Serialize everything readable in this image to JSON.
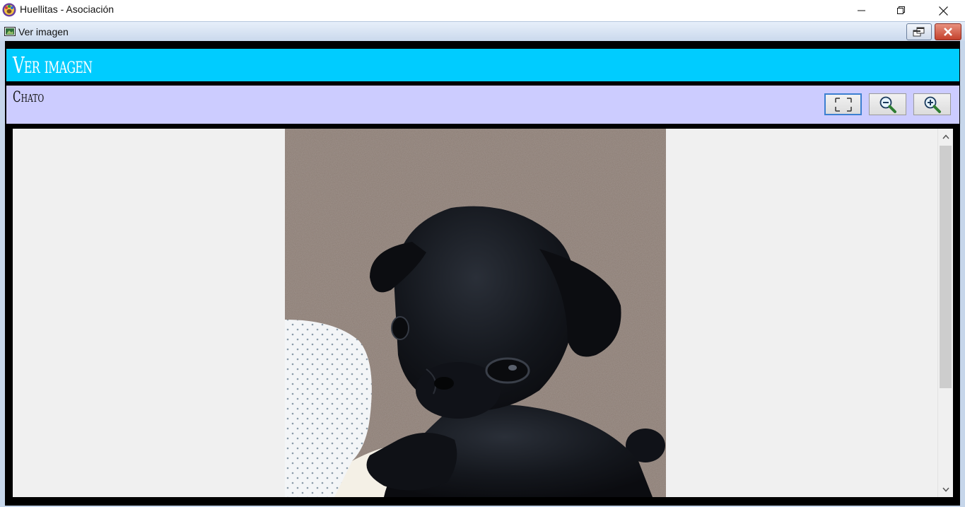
{
  "window": {
    "title": "Huellitas - Asociación",
    "app_icon": "paw-app-icon",
    "controls": [
      "minimize-icon",
      "maximize-icon",
      "close-icon"
    ]
  },
  "child_window": {
    "title": "Ver imagen",
    "icon": "image-window-icon",
    "controls": [
      "restore-icon",
      "close-icon"
    ]
  },
  "page": {
    "title": "Ver imagen",
    "header_color": "#00ccff",
    "subheader_color": "#ccccff"
  },
  "pet": {
    "name": "Chato"
  },
  "toolbar": {
    "buttons": [
      {
        "icon": "fit-to-window-icon",
        "focused": true
      },
      {
        "icon": "zoom-out-icon"
      },
      {
        "icon": "zoom-in-icon"
      }
    ]
  },
  "viewer": {
    "image": "black-pug-puppy-photo",
    "scroll_position": 0.0,
    "scroll_visible_fraction": 0.7
  }
}
